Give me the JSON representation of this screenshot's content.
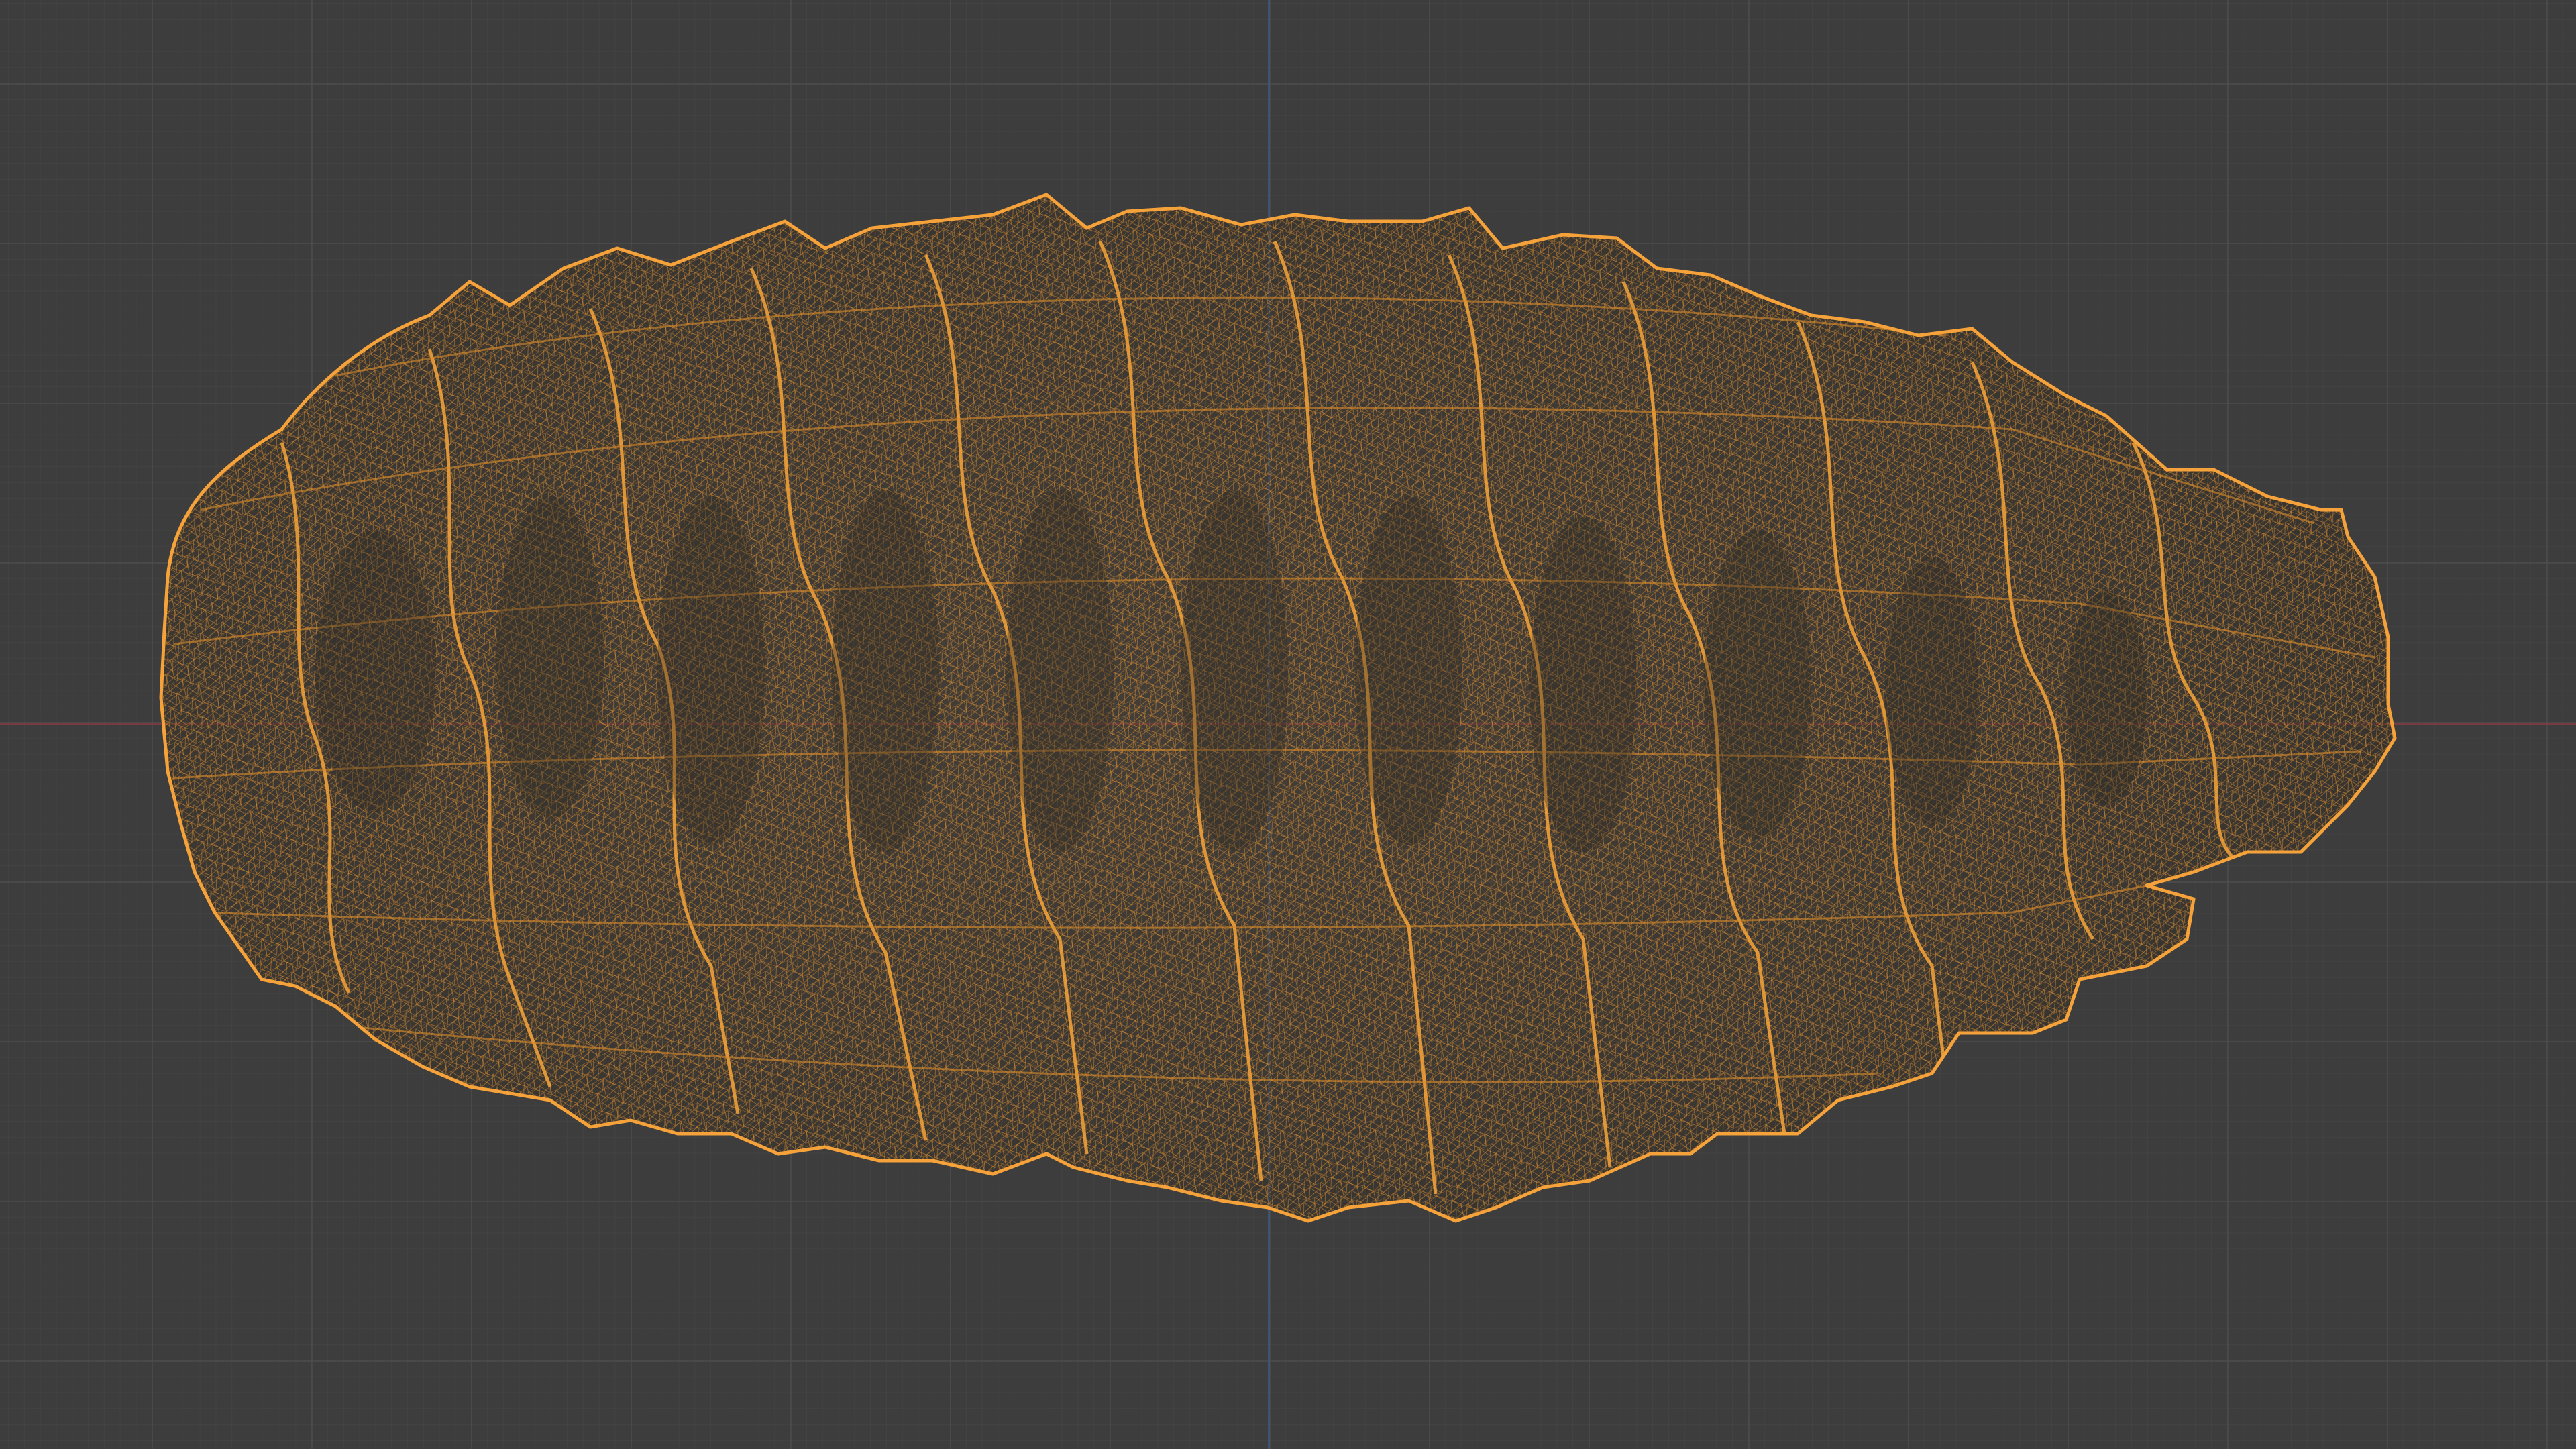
{
  "viewport": {
    "mode": "wireframe",
    "object": "pinecone-mesh",
    "colors": {
      "background": "#3d3d3d",
      "grid_minor": "#484848",
      "grid_major": "#505050",
      "axis_x": "#8a3c44",
      "axis_y": "#3d5a80",
      "wire": "#f29a2c",
      "wire_dim": "#a86a1f",
      "fill": "#4a3a26"
    }
  }
}
